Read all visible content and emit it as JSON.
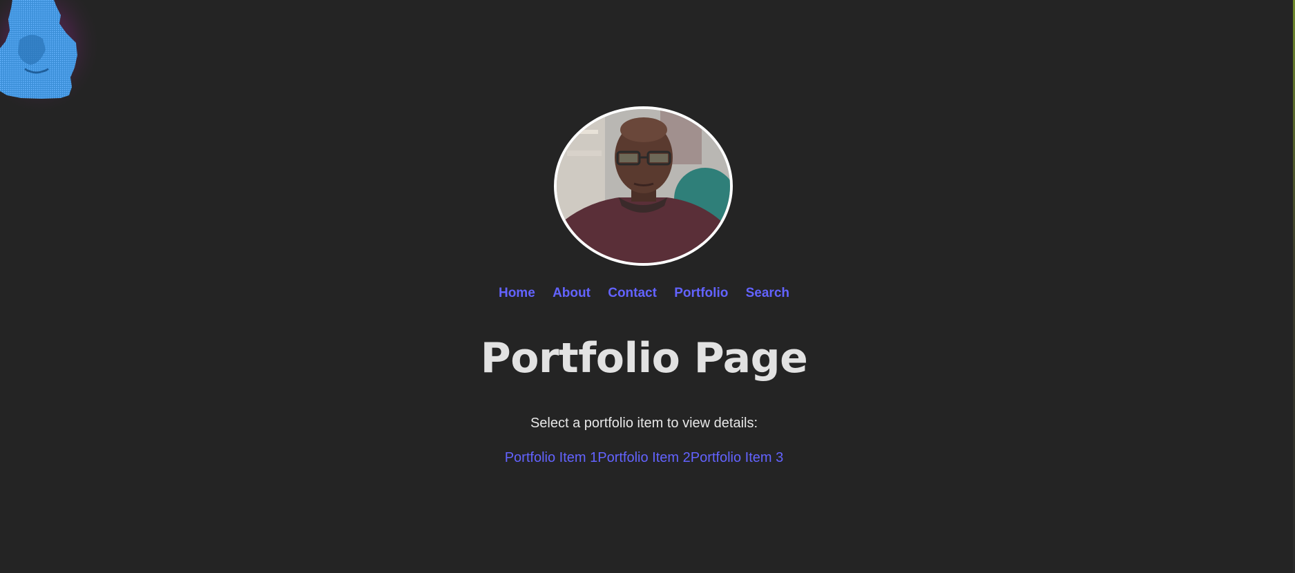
{
  "nav": {
    "items": [
      {
        "label": "Home"
      },
      {
        "label": "About"
      },
      {
        "label": "Contact"
      },
      {
        "label": "Portfolio"
      },
      {
        "label": "Search"
      }
    ]
  },
  "main": {
    "title": "Portfolio Page",
    "prompt": "Select a portfolio item to view details:",
    "portfolio_items": [
      {
        "label": "Portfolio Item 1"
      },
      {
        "label": "Portfolio Item 2"
      },
      {
        "label": "Portfolio Item 3"
      }
    ]
  },
  "colors": {
    "background": "#242424",
    "link": "#6363ff",
    "heading": "#e2e2e2",
    "text": "#e8e8e8"
  },
  "icons": {
    "corner_logo": "pixelated-bust-icon",
    "avatar": "profile-photo"
  }
}
